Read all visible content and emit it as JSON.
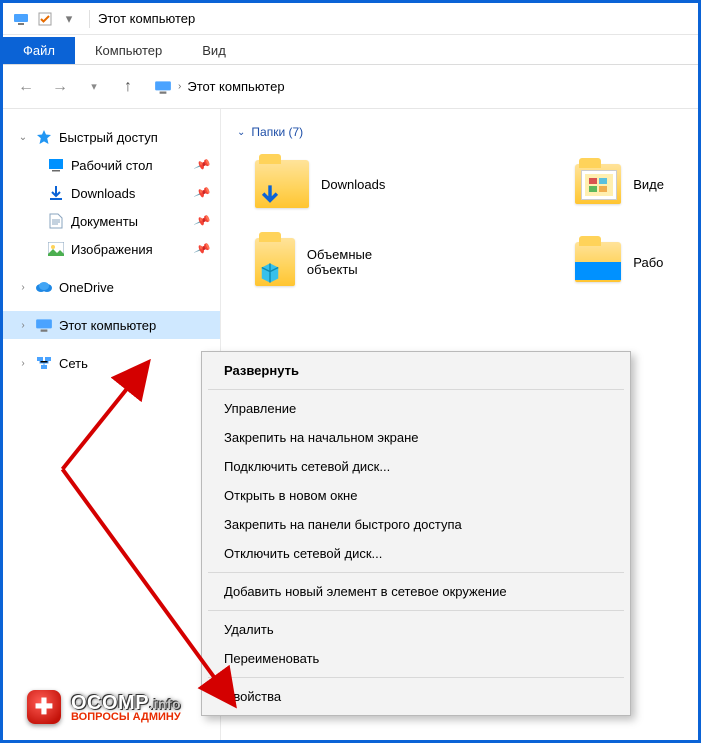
{
  "titlebar": {
    "title": "Этот компьютер"
  },
  "ribbon": {
    "tabs": [
      {
        "label": "Файл",
        "active": true
      },
      {
        "label": "Компьютер",
        "active": false
      },
      {
        "label": "Вид",
        "active": false
      }
    ]
  },
  "address": {
    "location": "Этот компьютер"
  },
  "sidebar": {
    "quick_access": {
      "label": "Быстрый доступ",
      "items": [
        {
          "label": "Рабочий стол"
        },
        {
          "label": "Downloads"
        },
        {
          "label": "Документы"
        },
        {
          "label": "Изображения"
        }
      ]
    },
    "onedrive": {
      "label": "OneDrive"
    },
    "this_pc": {
      "label": "Этот компьютер"
    },
    "network": {
      "label": "Сеть"
    }
  },
  "content": {
    "section_title": "Папки (7)",
    "folders_col1": [
      {
        "label": "Downloads",
        "overlay": "download"
      },
      {
        "label": "Объемные объекты",
        "overlay": "cube"
      }
    ],
    "folders_col2": [
      {
        "label": "Виде",
        "overlay": "video"
      },
      {
        "label": "Рабо",
        "overlay": "desktop"
      }
    ]
  },
  "context_menu": {
    "items": [
      {
        "label": "Развернуть",
        "bold": true
      },
      {
        "divider": true
      },
      {
        "label": "Управление"
      },
      {
        "label": "Закрепить на начальном экране"
      },
      {
        "label": "Подключить сетевой диск..."
      },
      {
        "label": "Открыть в новом окне"
      },
      {
        "label": "Закрепить на панели быстрого доступа"
      },
      {
        "label": "Отключить сетевой диск..."
      },
      {
        "divider": true
      },
      {
        "label": "Добавить новый элемент в сетевое окружение"
      },
      {
        "divider": true
      },
      {
        "label": "Удалить"
      },
      {
        "label": "Переименовать"
      },
      {
        "divider": true
      },
      {
        "label": "Свойства"
      }
    ]
  },
  "watermark": {
    "brand_main": "OCOMP",
    "brand_suffix": ".info",
    "subtitle": "ВОПРОСЫ АДМИНУ"
  },
  "icons": {
    "pc": "pc-icon",
    "check": "check-icon",
    "down": "chevron-down-icon",
    "back": "back-icon",
    "fwd": "forward-icon",
    "up": "up-icon",
    "star": "star-icon",
    "desktop": "desktop-icon",
    "download": "download-icon",
    "document": "document-icon",
    "pictures": "pictures-icon",
    "cloud": "onedrive-icon",
    "network": "network-icon",
    "pin": "pin-icon"
  }
}
